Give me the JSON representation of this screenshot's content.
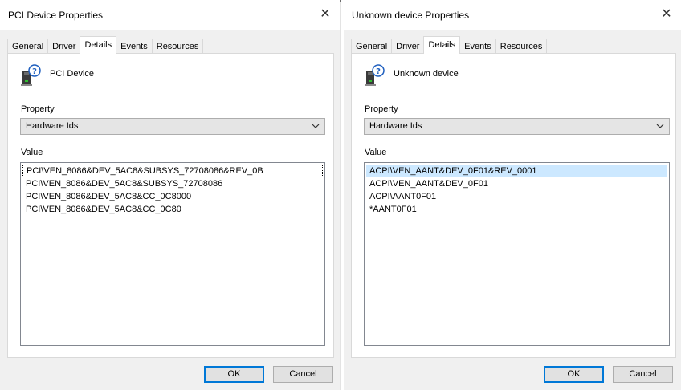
{
  "left_dialog": {
    "title": "PCI Device Properties",
    "close_glyph": "✕",
    "tabs": [
      {
        "label": "General",
        "active": false
      },
      {
        "label": "Driver",
        "active": false
      },
      {
        "label": "Details",
        "active": true
      },
      {
        "label": "Events",
        "active": false
      },
      {
        "label": "Resources",
        "active": false
      }
    ],
    "device_icon": "unknown-device-icon",
    "device_name": "PCI Device",
    "property_label": "Property",
    "property_value": "Hardware Ids",
    "value_label": "Value",
    "values": [
      "PCI\\VEN_8086&DEV_5AC8&SUBSYS_72708086&REV_0B",
      "PCI\\VEN_8086&DEV_5AC8&SUBSYS_72708086",
      "PCI\\VEN_8086&DEV_5AC8&CC_0C8000",
      "PCI\\VEN_8086&DEV_5AC8&CC_0C80"
    ],
    "ok_label": "OK",
    "cancel_label": "Cancel"
  },
  "right_dialog": {
    "title": "Unknown device Properties",
    "close_glyph": "✕",
    "tabs": [
      {
        "label": "General",
        "active": false
      },
      {
        "label": "Driver",
        "active": false
      },
      {
        "label": "Details",
        "active": true
      },
      {
        "label": "Events",
        "active": false
      },
      {
        "label": "Resources",
        "active": false
      }
    ],
    "device_icon": "unknown-device-icon",
    "device_name": "Unknown device",
    "property_label": "Property",
    "property_value": "Hardware Ids",
    "value_label": "Value",
    "values": [
      "ACPI\\VEN_AANT&DEV_0F01&REV_0001",
      "ACPI\\VEN_AANT&DEV_0F01",
      "ACPI\\AANT0F01",
      "*AANT0F01"
    ],
    "ok_label": "OK",
    "cancel_label": "Cancel"
  },
  "colors": {
    "dialog_bg": "#f0f0f0",
    "accent": "#0078d7",
    "selection": "#cce8ff"
  }
}
